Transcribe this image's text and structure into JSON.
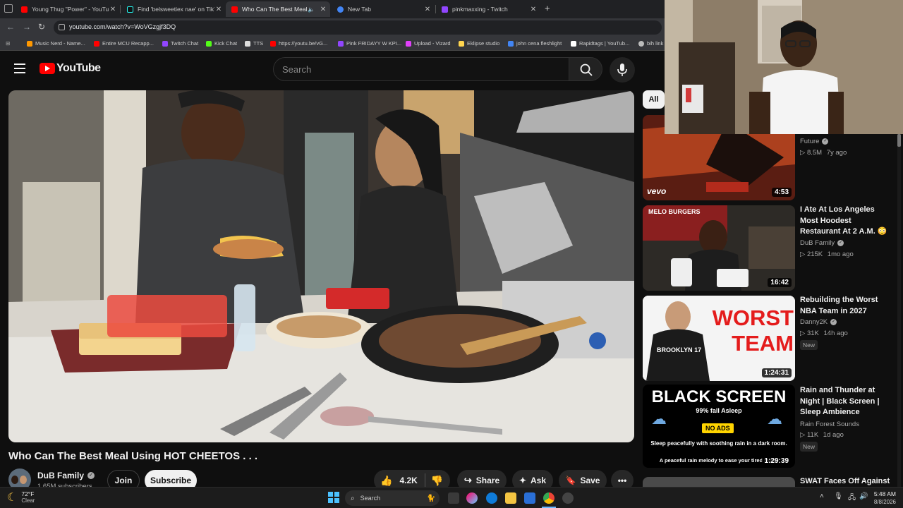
{
  "browser": {
    "tabs": [
      {
        "title": "Young Thug \"Power\" - YouTube",
        "favicon": "youtube-icon"
      },
      {
        "title": "Find 'belsweetiex nae' on TikTok",
        "favicon": "tiktok-icon"
      },
      {
        "title": "Who Can The Best Meal Us",
        "favicon": "youtube-icon",
        "active": true
      },
      {
        "title": "New Tab",
        "favicon": "chrome-icon"
      },
      {
        "title": "pinkmaxxing - Twitch",
        "favicon": "twitch-icon"
      }
    ],
    "url": "youtube.com/watch?v=WoVGzgjf3DQ",
    "bookmarks": [
      "Music Nerd - Name...",
      "Entire MCU Recapp...",
      "Twitch Chat",
      "Kick Chat",
      "TTS",
      "https://youtu.be/vG...",
      "Pink FRIDAYY W KPI...",
      "Upload - Vizard",
      "Eklipse studio",
      "john cena fleshlight",
      "Rapidtags | YouTub...",
      "bih link"
    ]
  },
  "youtube": {
    "logo_text": "YouTube",
    "search_placeholder": "Search",
    "video": {
      "title": "Who Can The Best Meal Using HOT CHEETOS . . .",
      "channel": "DuB Family",
      "subscribers": "1.65M subscribers",
      "join_label": "Join",
      "subscribe_label": "Subscribe",
      "likes": "4.2K",
      "share_label": "Share",
      "ask_label": "Ask",
      "save_label": "Save"
    },
    "filter_chip": "All",
    "recommendations": [
      {
        "title": "",
        "channel": "Future",
        "views": "8.5M",
        "age": "7y ago",
        "duration": "4:53",
        "thumb_text": "vevo"
      },
      {
        "title": "I Ate At Los Angeles Most Hoodest Restaurant At 2 A.M. 😳",
        "channel": "DuB Family",
        "views": "215K",
        "age": "1mo ago",
        "duration": "16:42",
        "thumb_text": "MELO BURGERS"
      },
      {
        "title": "Rebuilding the Worst NBA Team in 2027",
        "channel": "Danny2K",
        "views": "31K",
        "age": "14h ago",
        "badge": "New",
        "duration": "1:24:31",
        "thumb_text": "WORST TEAM",
        "thumb_jersey": "BROOKLYN 17"
      },
      {
        "title": "Rain and Thunder at Night | Black Screen | Sleep Ambience",
        "channel": "Rain Forest Sounds",
        "views": "11K",
        "age": "1d ago",
        "badge": "New",
        "duration": "1:29:39",
        "thumb_text": "BLACK SCREEN",
        "thumb_sub": "99% fall Asleep",
        "thumb_badge": "NO ADS",
        "thumb_caption1": "Sleep peacefully with soothing rain in a dark room.",
        "thumb_caption2": "A peaceful rain melody to ease your tired mind."
      },
      {
        "title": "SWAT Faces Off Against",
        "channel": "",
        "views": "",
        "age": ""
      }
    ]
  },
  "taskbar": {
    "weather_temp": "72°F",
    "weather_desc": "Clear",
    "search_label": "Search",
    "time": "5:48 AM",
    "date": "8/8/2026"
  },
  "colors": {
    "youtube_red": "#ff0000",
    "background": "#0f0f0f",
    "chrome_bg": "#202124"
  }
}
